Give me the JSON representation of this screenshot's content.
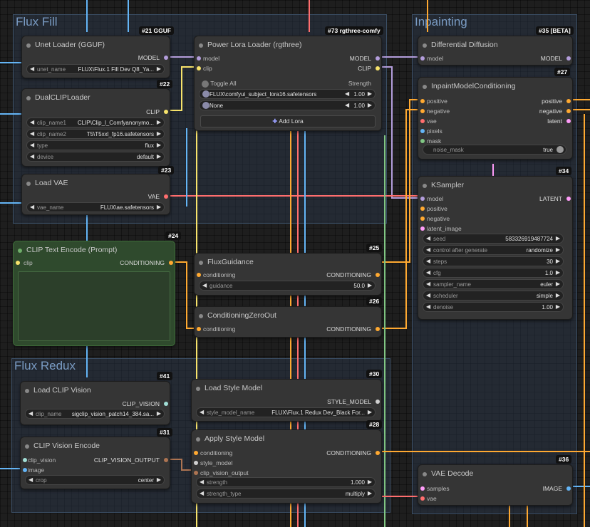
{
  "groups": {
    "flux_fill": "Flux Fill",
    "inpainting": "Inpainting",
    "flux_redux": "Flux Redux"
  },
  "nodes": {
    "unet": {
      "badge": "#21 GGUF",
      "title": "Unet Loader (GGUF)",
      "out": "MODEL",
      "widget_label": "unet_name",
      "widget_value": "FLUX\\Flux.1 Fill Dev Q8_Ya...",
      "id": "#22"
    },
    "dualclip": {
      "title": "DualCLIPLoader",
      "out": "CLIP",
      "w1_label": "clip_name1",
      "w1_value": "CLIP\\Clip_l_Comfyanonymo...",
      "w2_label": "clip_name2",
      "w2_value": "T5\\T5xxl_fp16.safetensors",
      "w3_label": "type",
      "w3_value": "flux",
      "w4_label": "device",
      "w4_value": "default",
      "id": "#23"
    },
    "loadvae": {
      "title": "Load VAE",
      "out": "VAE",
      "widget_label": "vae_name",
      "widget_value": "FLUX\\ae.safetensors"
    },
    "lora": {
      "badge": "#73 rgthree-comfy",
      "title": "Power Lora Loader (rgthree)",
      "in1": "model",
      "in2": "clip",
      "out1": "MODEL",
      "out2": "CLIP",
      "toggle_all": "Toggle All",
      "strength": "Strength",
      "lora1": "FLUX\\comfyui_subject_lora16.safetensors",
      "lora1_val": "1.00",
      "lora2": "None",
      "lora2_val": "1.00",
      "add": "Add Lora"
    },
    "clipenc": {
      "id": "#24",
      "title": "CLIP Text Encode (Prompt)",
      "in": "clip",
      "out": "CONDITIONING"
    },
    "guidance": {
      "id": "#25",
      "title": "FluxGuidance",
      "in": "conditioning",
      "out": "CONDITIONING",
      "widget_label": "guidance",
      "widget_value": "50.0"
    },
    "zeroout": {
      "id": "#26",
      "title": "ConditioningZeroOut",
      "in": "conditioning",
      "out": "CONDITIONING"
    },
    "diffdiff": {
      "badge": "#35 [BETA]",
      "title": "Differential Diffusion",
      "in": "model",
      "out": "MODEL",
      "id": "#27"
    },
    "inpaint": {
      "title": "InpaintModelConditioning",
      "in1": "positive",
      "in2": "negative",
      "in3": "vae",
      "in4": "pixels",
      "in5": "mask",
      "out1": "positive",
      "out2": "negative",
      "out3": "latent",
      "toggle_label": "noise_mask",
      "toggle_value": "true"
    },
    "ksampler": {
      "id": "#34",
      "title": "KSampler",
      "out": "LATENT",
      "in1": "model",
      "in2": "positive",
      "in3": "negative",
      "in4": "latent_image",
      "seed_l": "seed",
      "seed_v": "583326919487724",
      "cag_l": "control after generate",
      "cag_v": "randomize",
      "steps_l": "steps",
      "steps_v": "30",
      "cfg_l": "cfg",
      "cfg_v": "1.0",
      "sampler_l": "sampler_name",
      "sampler_v": "euler",
      "sched_l": "scheduler",
      "sched_v": "simple",
      "denoise_l": "denoise",
      "denoise_v": "1.00"
    },
    "clipvision": {
      "id": "#41",
      "title": "Load CLIP Vision",
      "out": "CLIP_VISION",
      "widget_label": "clip_name",
      "widget_value": "sigclip_vision_patch14_384.sa..."
    },
    "stylemodel": {
      "id": "#30",
      "title": "Load Style Model",
      "out": "STYLE_MODEL",
      "widget_label": "style_model_name",
      "widget_value": "FLUX\\Flux.1 Redux Dev_Black For...",
      "id2": "#28"
    },
    "cvencode": {
      "id": "#31",
      "title": "CLIP Vision Encode",
      "in1": "clip_vision",
      "in2": "image",
      "out": "CLIP_VISION_OUTPUT",
      "widget_label": "crop",
      "widget_value": "center"
    },
    "applystyle": {
      "title": "Apply Style Model",
      "in1": "conditioning",
      "in2": "style_model",
      "in3": "clip_vision_output",
      "out": "CONDITIONING",
      "w1_label": "strength",
      "w1_value": "1.000",
      "w2_label": "strength_type",
      "w2_value": "multiply"
    },
    "vaedecode": {
      "id": "#36",
      "title": "VAE Decode",
      "in1": "samples",
      "in2": "vae",
      "out": "IMAGE"
    }
  },
  "colors": {
    "model": "#b39ddb",
    "clip": "#f7e36b",
    "vae": "#ff6e6e",
    "conditioning": "#ffa931",
    "image": "#64b5f6",
    "mask": "#81c784",
    "latent": "#ff9cf9"
  }
}
